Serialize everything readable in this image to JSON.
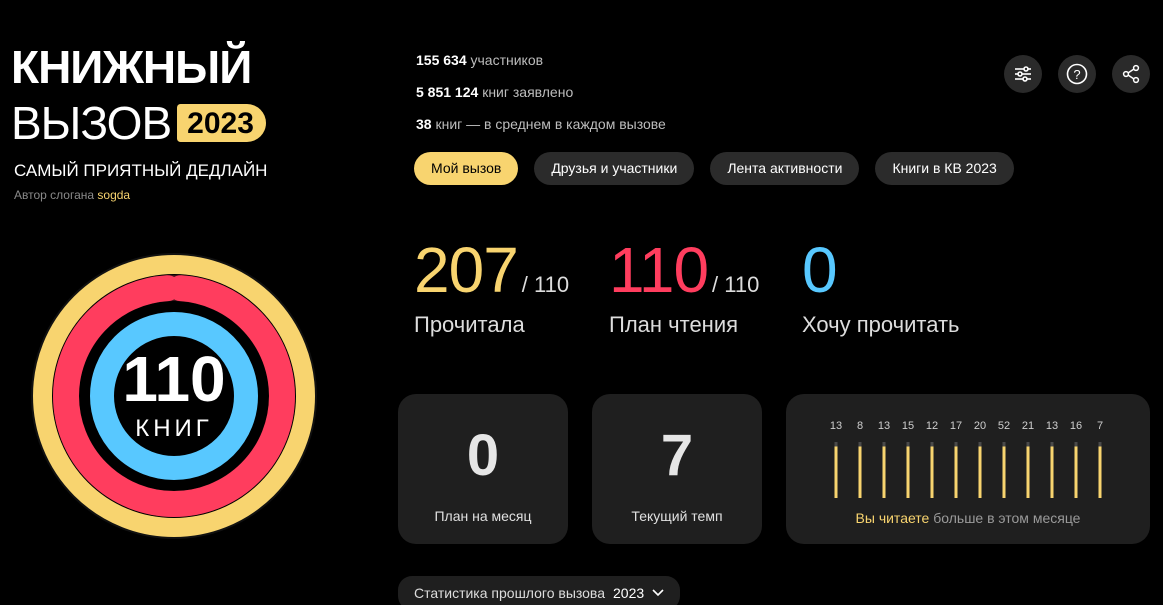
{
  "logo": {
    "line1": "КНИЖНЫЙ",
    "line2": "ВЫЗОВ",
    "year": "2023"
  },
  "slogan": {
    "text": "САМЫЙ ПРИЯТНЫЙ ДЕДЛАЙН",
    "author_prefix": "Автор слогана",
    "author": "sogda"
  },
  "stats": [
    {
      "value": "155 634",
      "text": "участников"
    },
    {
      "value": "5 851 124",
      "text": "книг заявлено"
    },
    {
      "value": "38",
      "text": "книг — в среднем в каждом вызове"
    }
  ],
  "icons": [
    "filter-icon",
    "help-icon",
    "share-icon"
  ],
  "tabs": [
    {
      "label": "Мой вызов",
      "active": true
    },
    {
      "label": "Друзья и участники",
      "active": false
    },
    {
      "label": "Лента активности",
      "active": false
    },
    {
      "label": "Книги в КВ 2023",
      "active": false
    }
  ],
  "ring": {
    "number": "110",
    "unit": "КНИГ",
    "read_fraction": 1.0,
    "plan_fraction": 0.98,
    "want_fraction": 1.0
  },
  "counters": {
    "read": {
      "value": "207",
      "of": "/ 110",
      "label": "Прочитала",
      "color": "#f8d46f"
    },
    "plan": {
      "value": "110",
      "of": "/ 110",
      "label": "План чтения",
      "color": "#ff3d5e"
    },
    "want": {
      "value": "0",
      "label": "Хочу прочитать",
      "color": "#58c8ff"
    }
  },
  "cards": {
    "month_plan": {
      "value": "0",
      "label": "План на месяц"
    },
    "pace": {
      "value": "7",
      "label": "Текущий темп"
    }
  },
  "chart_data": {
    "type": "bar",
    "values": [
      13,
      8,
      13,
      15,
      12,
      17,
      20,
      52,
      21,
      13,
      16,
      7
    ],
    "color": "#f8d46f",
    "footer_highlight": "Вы читаете",
    "footer_rest": "больше в этом месяце"
  },
  "prev_stats": {
    "label": "Статистика прошлого вызова",
    "year": "2023"
  }
}
